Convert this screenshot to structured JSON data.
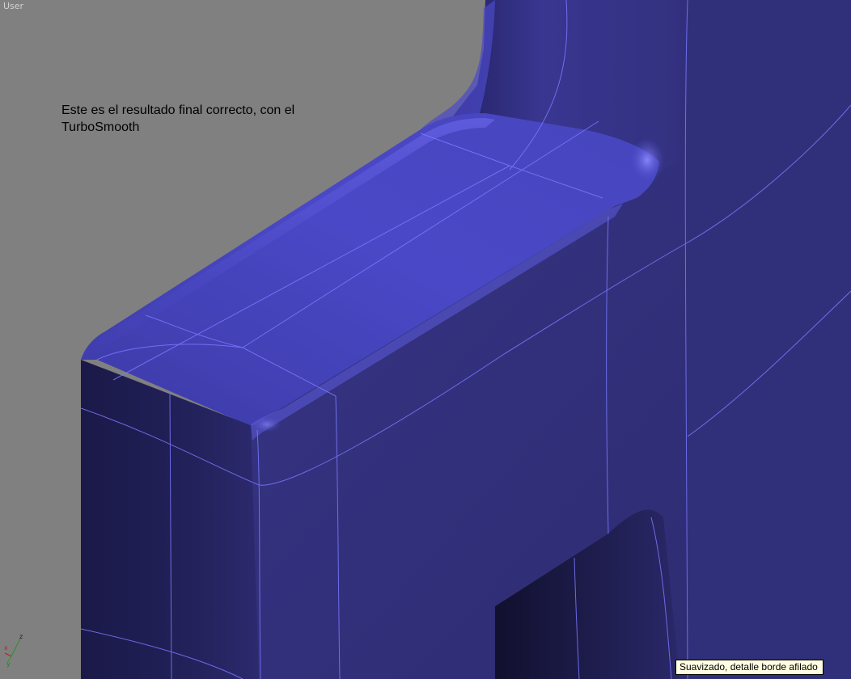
{
  "viewport": {
    "label": "User",
    "background": "#808080"
  },
  "scene": {
    "object_color": "#34327e",
    "highlight_color": "#4a48c6",
    "wire_color": "#7a78ff"
  },
  "annotation": {
    "text": "Este es el resultado final correcto, con el TurboSmooth"
  },
  "tooltip": {
    "text": "Suavizado, detalle borde afilado"
  },
  "axis_gizmo": {
    "x": "x",
    "y": "y",
    "z": "z"
  }
}
